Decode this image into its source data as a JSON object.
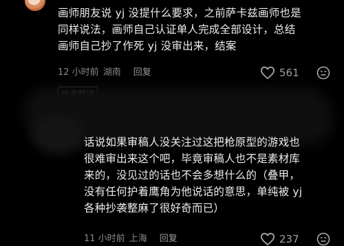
{
  "comment1": {
    "text_lines": [
      "画师朋友说 yj 没提什么要求，之前萨卡兹画师也是",
      "同样说法，画师自己认证单人完成全部设计，总结",
      "画师自己抄了作死 yj 没审出来，结案"
    ],
    "time": "12 小时前",
    "location": "湖南",
    "reply_label": "回复",
    "likes": "561"
  },
  "author_tag": "作者赞过",
  "comment2": {
    "text_lines": [
      "话说如果审稿人没关注过这把枪原型的游戏也",
      "很难审出来这个吧，毕竟审稿人也不是素材库",
      "来的，没见过的话也不会多想什么的（叠甲，",
      "没有任何护着鹰角为他说话的意思，单纯被 yj",
      "各种抄袭整麻了很好奇而已）"
    ],
    "time": "11 小时前",
    "location": "上海",
    "reply_label": "回复",
    "likes": "237"
  },
  "icons": {
    "like": "heart-icon",
    "dislike": "dislike-face-icon"
  },
  "colors": {
    "background": "#000000",
    "text": "#ececec",
    "meta": "#8a8a8a"
  }
}
